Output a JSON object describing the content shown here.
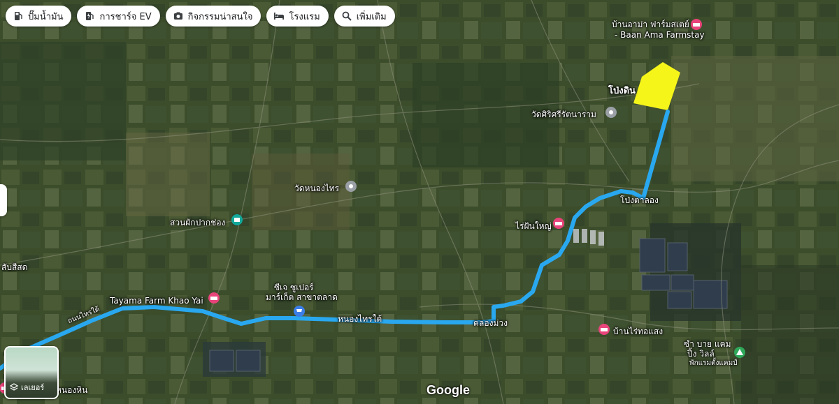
{
  "chips": [
    {
      "label": "ปั๊มน้ำมัน",
      "icon": "gas-station-icon"
    },
    {
      "label": "การชาร์จ EV",
      "icon": "ev-charger-icon"
    },
    {
      "label": "กิจกรรมน่าสนใจ",
      "icon": "camera-icon"
    },
    {
      "label": "โรงแรม",
      "icon": "bed-icon"
    },
    {
      "label": "เพิ่มเติม",
      "icon": "search-icon"
    }
  ],
  "places": {
    "baan_ama_th": "บ้านอาม่า ฟาร์มสเตย์",
    "baan_ama_en": "- Baan Ama Farmstay",
    "pong_ta_lat": "โป่งดิน",
    "wat_sri": "วัดศิริศรีรัตนาราม",
    "wat_nong_krai": "วัดหนองไทร",
    "suan_phak": "สวนผักปากช่อง",
    "pong_ta_long": "โป่งตาลอง",
    "rai_fin_yai": "ไร่ฝันใหญ่",
    "sub_sida": "สับสีสด",
    "tayama": "Tayama Farm Khao Yai",
    "cj_super_1": "ซีเจ ซูเปอร์",
    "cj_super_2": "มาร์เก็ต สาขาตลาด",
    "nong_krai_tai": "หนองไทรใต้",
    "klong_muang": "คลองม่วง",
    "baan_rai_kho_saeng": "บ้านไร่ทอแสง",
    "camping_1": "ซำ บาย แคม",
    "camping_2": "ปิ้ง วิลล์",
    "camping_3": "พักแรมตั้งแคมป์",
    "nong_hin": "หนองหิน",
    "road_label": "ถนนไทรใต้"
  },
  "layers_label": "เลเยอร์",
  "attribution": "Google",
  "colors": {
    "route": "#29a8f0",
    "highlight": "#f5f51a",
    "pin_pink": "#e8437a",
    "pin_teal": "#12a89a",
    "pin_blue": "#3b7ee8",
    "pin_gray": "#9aa0a6",
    "pin_green": "#2fa85a"
  }
}
